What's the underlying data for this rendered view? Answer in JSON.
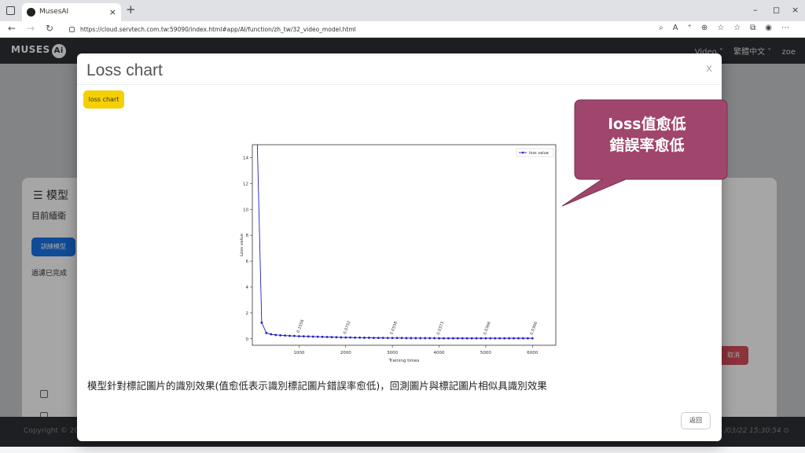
{
  "browser": {
    "tab_title": "MusesAI",
    "tab_close": "×",
    "new_tab": "+",
    "url": "https://cloud.servtech.com.tw:59090/index.html#app/AI/function/zh_tw/32_video_model.html",
    "window_controls": [
      "–",
      "◻",
      "×"
    ]
  },
  "app": {
    "logo_text": "MUSES",
    "logo_ai": "Ai",
    "header_items": [
      "Video ˅",
      "繁體中文 ˅",
      "zoe"
    ]
  },
  "page": {
    "card_title": "模型",
    "card_desc": "目前緬衛",
    "train_button": "訓練模型",
    "done_text": "過濾已完成",
    "cancel_button": "取消",
    "footer_left": "Copyright © 20",
    "footer_right": "/03/22 15:30:54 ⊙"
  },
  "modal": {
    "title": "Loss chart",
    "close": "x",
    "pill_label": "loss chart",
    "caption": "模型針對標記圖片的識別效果(值愈低表示識別標記圖片錯誤率愈低)，回測圖片與標記圖片相似具識別效果",
    "back_button": "返回"
  },
  "callout": {
    "line1": "loss值愈低",
    "line2": "錯誤率愈低",
    "color": "#a0456b"
  },
  "chart_data": {
    "type": "line",
    "xlabel": "Training times",
    "ylabel": "Loss value",
    "xlim": [
      0,
      6500
    ],
    "ylim": [
      -0.5,
      15
    ],
    "xticks": [
      1000,
      2000,
      3000,
      4000,
      5000,
      6000
    ],
    "yticks": [
      0,
      2,
      4,
      6,
      8,
      10,
      12,
      14
    ],
    "grid": false,
    "legend": "top-right",
    "series": [
      {
        "name": "loss value",
        "color": "#1f1fbf",
        "x": [
          100,
          200,
          300,
          400,
          500,
          600,
          700,
          800,
          900,
          1000,
          1100,
          1200,
          1300,
          1400,
          1500,
          1600,
          1700,
          1800,
          1900,
          2000,
          2100,
          2200,
          2300,
          2400,
          2500,
          2600,
          2700,
          2800,
          2900,
          3000,
          3100,
          3200,
          3300,
          3400,
          3500,
          3600,
          3700,
          3800,
          3900,
          4000,
          4100,
          4200,
          4300,
          4400,
          4500,
          4600,
          4700,
          4800,
          4900,
          5000,
          5100,
          5200,
          5300,
          5400,
          5500,
          5600,
          5700,
          5800,
          5900,
          6000
        ],
        "y": [
          16,
          1.25,
          0.45,
          0.35,
          0.3,
          0.27,
          0.25,
          0.23,
          0.22,
          0.2,
          0.19,
          0.18,
          0.17,
          0.16,
          0.15,
          0.14,
          0.13,
          0.12,
          0.11,
          0.1,
          0.1,
          0.09,
          0.09,
          0.08,
          0.08,
          0.07,
          0.07,
          0.07,
          0.06,
          0.06,
          0.06,
          0.06,
          0.05,
          0.05,
          0.05,
          0.05,
          0.05,
          0.05,
          0.05,
          0.04,
          0.04,
          0.04,
          0.04,
          0.04,
          0.04,
          0.04,
          0.04,
          0.04,
          0.04,
          0.04,
          0.04,
          0.04,
          0.04,
          0.04,
          0.04,
          0.04,
          0.04,
          0.04,
          0.04,
          0.04
        ]
      }
    ],
    "annotations": [
      {
        "x": 1000,
        "y": 0.2,
        "text": "0.1556"
      },
      {
        "x": 2000,
        "y": 0.1,
        "text": "0.0752"
      },
      {
        "x": 3000,
        "y": 0.06,
        "text": "0.0558"
      },
      {
        "x": 4000,
        "y": 0.04,
        "text": "0.0373"
      },
      {
        "x": 5000,
        "y": 0.04,
        "text": "0.0366"
      },
      {
        "x": 6000,
        "y": 0.04,
        "text": "0.0366"
      }
    ]
  }
}
